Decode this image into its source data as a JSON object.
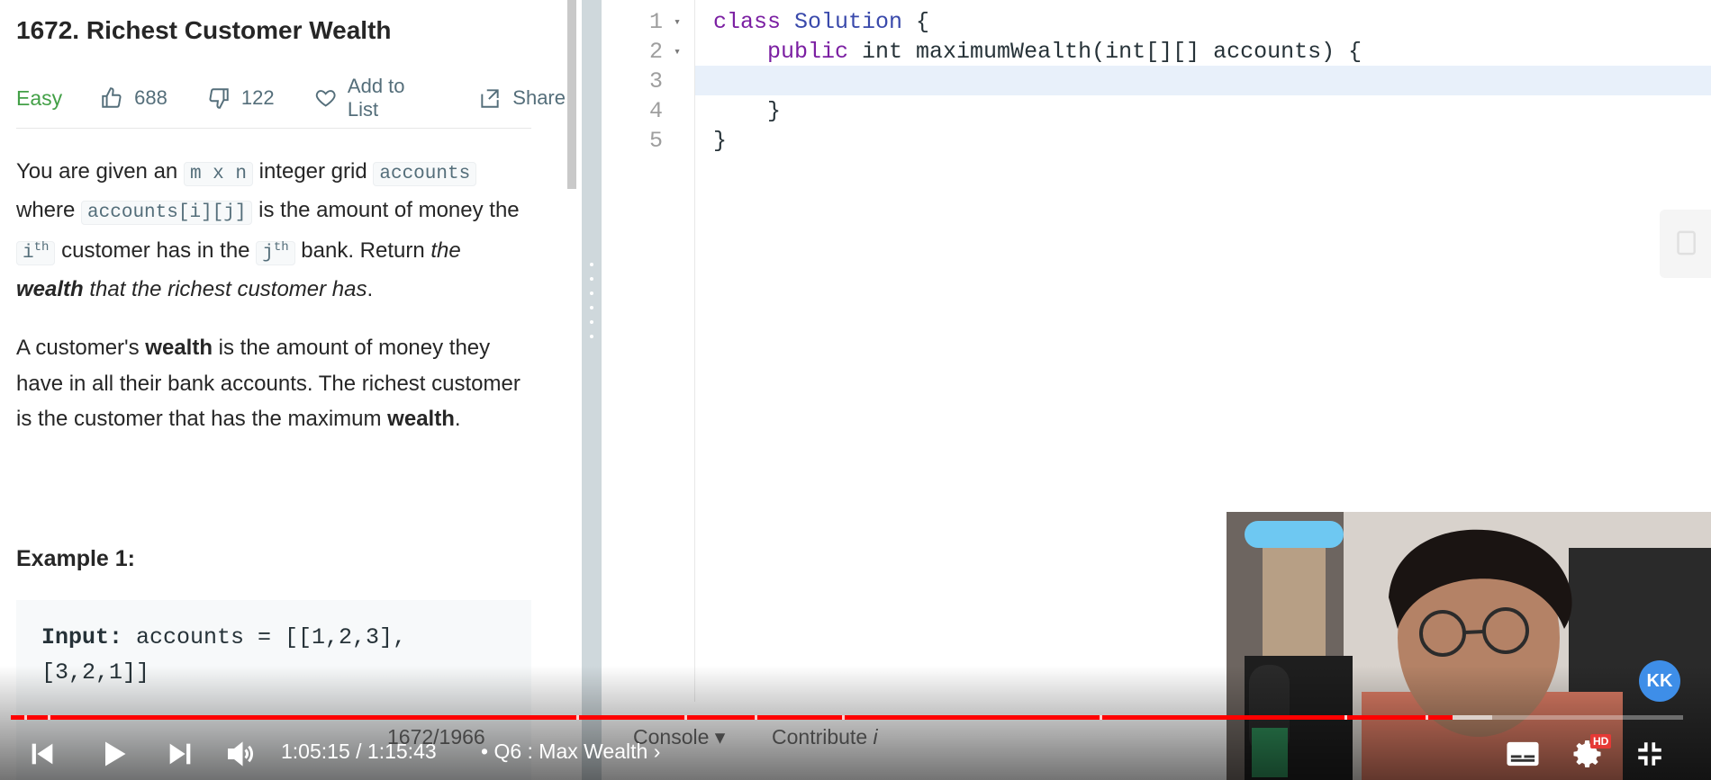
{
  "problem": {
    "title": "1672. Richest Customer Wealth",
    "difficulty": "Easy",
    "likes": "688",
    "dislikes": "122",
    "add_to_list": "Add to List",
    "share": "Share",
    "desc_p1_a": "You are given an ",
    "code_mxn": "m x n",
    "desc_p1_b": " integer grid ",
    "code_accounts": "accounts",
    "desc_p1_c": " where ",
    "code_accij": "accounts[i][j]",
    "desc_p1_d": " is the amount of money the ",
    "code_i": "i",
    "sup_th1": "th",
    "desc_p1_e": " customer has in the ",
    "code_j": "j",
    "sup_th2": "th",
    "desc_p1_f": " bank. Return ",
    "desc_p1_g": "the ",
    "desc_p1_bold": "wealth",
    "desc_p1_h": " that the richest customer has",
    "desc_p1_end": ".",
    "desc_p2_a": "A customer's ",
    "desc_p2_bold1": "wealth",
    "desc_p2_b": " is the amount of money they have in all their bank accounts. The richest customer is the customer that has the maximum ",
    "desc_p2_bold2": "wealth",
    "desc_p2_end": ".",
    "example_title": "Example 1:",
    "example_input_label": "Input:",
    "example_input_value": " accounts = [[1,2,3],[3,2,1]]"
  },
  "editor": {
    "lines": [
      {
        "num": "1",
        "fold": "▾"
      },
      {
        "num": "2",
        "fold": "▾"
      },
      {
        "num": "3",
        "fold": ""
      },
      {
        "num": "4",
        "fold": ""
      },
      {
        "num": "5",
        "fold": ""
      }
    ],
    "l1_kw": "class",
    "l1_cls": " Solution",
    "l1_rest": " {",
    "l2_indent": "    ",
    "l2_kw": "public",
    "l2_rest": " int maximumWealth(int[][] accounts) {",
    "l4": "    }",
    "l5": "}"
  },
  "bottom": {
    "pager": "1672/1966",
    "console": "Console",
    "contribute": "Contribute",
    "contribute_i": "i"
  },
  "player": {
    "time": "1:05:15 / 1:15:43",
    "chapter": "• Q6 : Max Wealth",
    "progress": 0.862,
    "buffered": 0.886,
    "hd_badge": "HD",
    "kk": "KK"
  }
}
